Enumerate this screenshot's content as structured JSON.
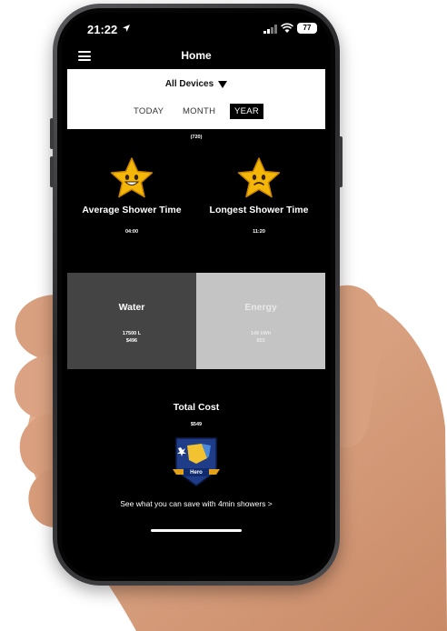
{
  "status_bar": {
    "time": "21:22",
    "battery": "77"
  },
  "header": {
    "title": "Home"
  },
  "filter": {
    "device": "All Devices",
    "tabs": [
      {
        "label": "TODAY",
        "active": false
      },
      {
        "label": "MONTH",
        "active": false
      },
      {
        "label": "YEAR",
        "active": true
      }
    ]
  },
  "stats": {
    "shower_count": "(720)",
    "average": {
      "label": "Average Shower Time",
      "value": "04:00",
      "icon": "smiling-star-icon"
    },
    "longest": {
      "label": "Longest Shower Time",
      "value": "11:20",
      "icon": "frowning-star-icon"
    }
  },
  "tiles": {
    "water": {
      "title": "Water",
      "amount": "17500 L",
      "cost": "$496"
    },
    "energy": {
      "title": "Energy",
      "amount": "148 kWh",
      "cost": "$53"
    }
  },
  "total": {
    "title": "Total Cost",
    "value": "$549"
  },
  "badge": {
    "label": "Hero",
    "icon": "hero-badge-icon"
  },
  "cta": {
    "label": "See what you can save with 4min showers >"
  },
  "colors": {
    "screen_bg": "#000000",
    "water_tile": "#444444",
    "energy_tile": "#c4c4c4",
    "star": "#f5b60a",
    "badge": "#1f3c88"
  }
}
